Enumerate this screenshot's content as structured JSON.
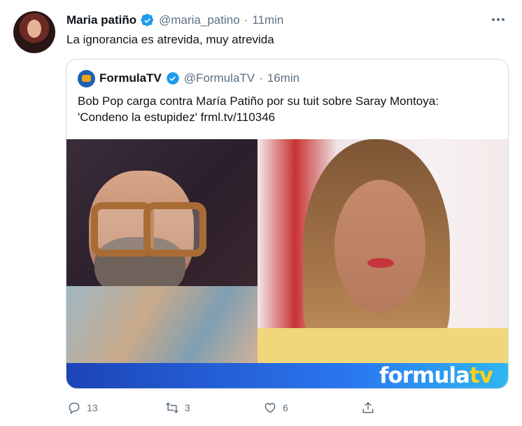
{
  "tweet": {
    "name": "Maria patiño",
    "handle": "@maria_patino",
    "separator": "·",
    "time": "11min",
    "text": "La ignorancia es atrevida, muy atrevida",
    "verified_icon": "verified-badge-icon",
    "more_icon": "more-options-icon"
  },
  "quote": {
    "name": "FormulaTV",
    "handle": "@FormulaTV",
    "separator": "·",
    "time": "16min",
    "text_line1": "Bob Pop carga contra María Patiño por su tuit sobre Saray Montoya:",
    "text_line2": "'Condeno la estupidez' frml.tv/110346",
    "logo_icon": "formulatv-logo-icon",
    "image": {
      "banner_left": "formula",
      "banner_right": "tv"
    }
  },
  "actions": {
    "reply_count": "13",
    "retweet_count": "3",
    "like_count": "6",
    "reply_icon": "reply-icon",
    "retweet_icon": "retweet-icon",
    "like_icon": "heart-icon",
    "share_icon": "share-icon"
  },
  "colors": {
    "verified": "#1d9bf0",
    "secondary_text": "#5b7083",
    "banner_blue": "#2a77f0",
    "banner_yellow": "#ffd31a"
  }
}
